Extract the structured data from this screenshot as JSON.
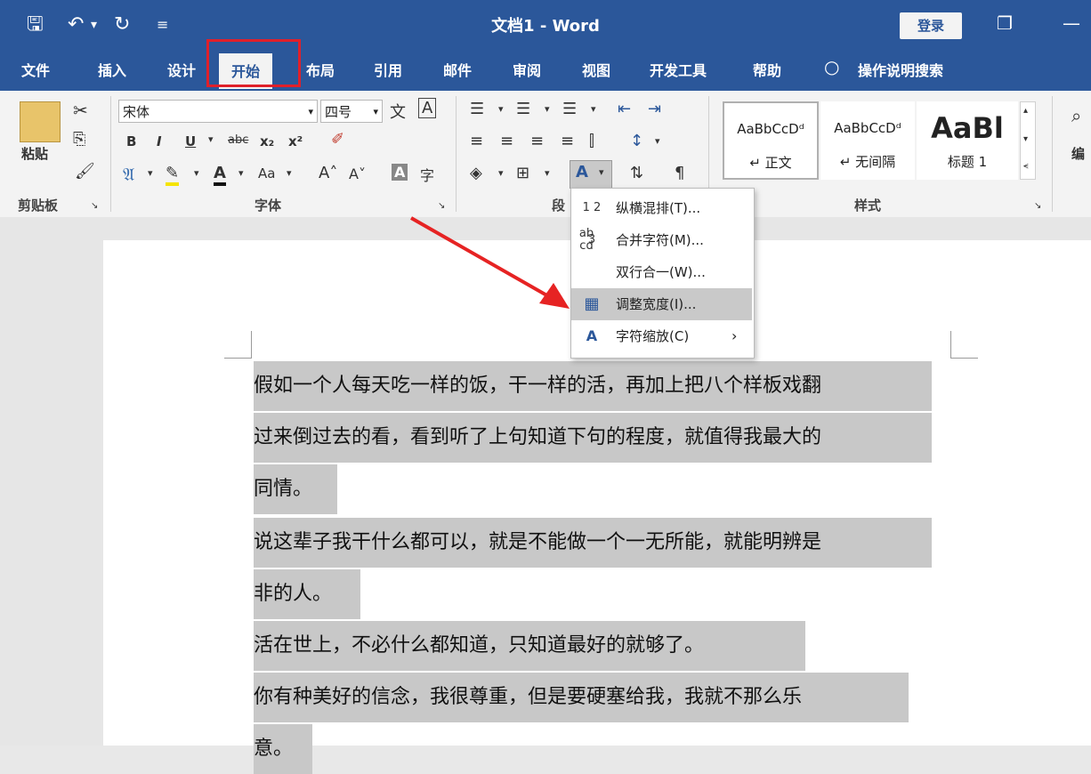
{
  "window": {
    "title": "文档1 - Word",
    "login": "登录"
  },
  "tabs": [
    "文件",
    "插入",
    "设计",
    "开始",
    "布局",
    "引用",
    "邮件",
    "审阅",
    "视图",
    "开发工具",
    "帮助",
    "操作说明搜索"
  ],
  "ribbon": {
    "clipboard": {
      "paste": "粘贴",
      "label": "剪贴板"
    },
    "font": {
      "name": "宋体",
      "size": "四号",
      "label": "字体",
      "row2": [
        "B",
        "I",
        "U",
        "abc",
        "x₂",
        "x²"
      ],
      "row3": [
        "A",
        "Aa"
      ]
    },
    "paragraph": {
      "label": "段"
    },
    "styles": {
      "label": "样式",
      "items": [
        {
          "sample": "AaBbCcDᵈ",
          "name": "↵ 正文"
        },
        {
          "sample": "AaBbCcDᵈ",
          "name": "↵ 无间隔"
        },
        {
          "sample": "AaBl",
          "name": "标题 1"
        }
      ]
    },
    "edit": {
      "label": "编"
    }
  },
  "menu": [
    {
      "icon": "1 2 3",
      "label": "纵横混排(T)..."
    },
    {
      "icon": "ab cd",
      "label": "合并字符(M)..."
    },
    {
      "icon": "",
      "label": "双行合一(W)..."
    },
    {
      "icon": "▦",
      "label": "调整宽度(I)..."
    },
    {
      "icon": "A",
      "label": "字符缩放(C)",
      "sub": "›"
    }
  ],
  "document": {
    "lines": [
      "假如一个人每天吃一样的饭，干一样的活，再加上把八个样板戏翻",
      "过来倒过去的看，看到听了上句知道下句的程度，就值得我最大的",
      "同情。",
      "说这辈子我干什么都可以，就是不能做一个一无所能，就能明辨是",
      "非的人。",
      "活在世上，不必什么都知道，只知道最好的就够了。",
      "你有种美好的信念，我很尊重，但是要硬塞给我，我就不那么乐",
      "意。"
    ]
  }
}
